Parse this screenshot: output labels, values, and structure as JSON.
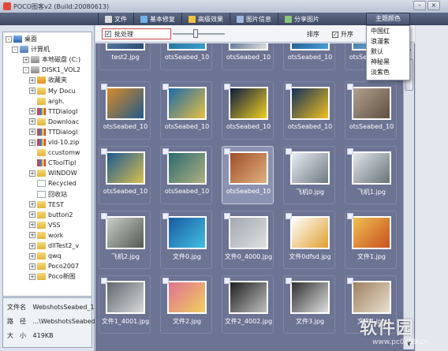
{
  "window": {
    "title": "POCO图客v2 (Build:20080613)"
  },
  "toolbar": {
    "items": [
      {
        "label": "文件",
        "icon": "file-icon",
        "color": "#d9d9d9"
      },
      {
        "label": "基本修复",
        "icon": "repair-icon",
        "color": "#6fb0e8"
      },
      {
        "label": "高级效果",
        "icon": "effects-icon",
        "color": "#f0c040"
      },
      {
        "label": "图片信息",
        "icon": "info-icon",
        "color": "#9fb8e0"
      },
      {
        "label": "分享图片",
        "icon": "share-icon",
        "color": "#8ac47a"
      }
    ],
    "theme_label": "主题颜色"
  },
  "theme_menu": {
    "items": [
      "中国红",
      "浪漫紫",
      "默认",
      "神秘黑",
      "淡紫色"
    ]
  },
  "tree": {
    "items": [
      {
        "label": "桌面",
        "icon": "desktop",
        "expander": "-"
      },
      {
        "label": "计算机",
        "icon": "computer",
        "expander": "-"
      },
      {
        "label": "本地磁盘 (C:)",
        "icon": "drive",
        "expander": "+"
      },
      {
        "label": "DISK1_VOL2",
        "icon": "drive",
        "expander": "-"
      },
      {
        "label": "收藏夹",
        "icon": "special",
        "expander": "+"
      },
      {
        "label": "My Docu",
        "icon": "folder",
        "expander": "+"
      },
      {
        "label": "argh.",
        "icon": "folder",
        "expander": ""
      },
      {
        "label": "TTDialogl",
        "icon": "zip",
        "expander": "+"
      },
      {
        "label": "Downloac",
        "icon": "folder",
        "expander": "+"
      },
      {
        "label": "TTDialogl",
        "icon": "zip",
        "expander": "+"
      },
      {
        "label": "vld-10.zip",
        "icon": "zip",
        "expander": "+"
      },
      {
        "label": "ccustomw",
        "icon": "folder",
        "expander": ""
      },
      {
        "label": "CToolTipl",
        "icon": "zip",
        "expander": ""
      },
      {
        "label": "WINDOW",
        "icon": "folder",
        "expander": "+"
      },
      {
        "label": "Recycled",
        "icon": "file",
        "expander": ""
      },
      {
        "label": "回收站",
        "icon": "file",
        "expander": ""
      },
      {
        "label": "TEST",
        "icon": "folder",
        "expander": "+"
      },
      {
        "label": "button2",
        "icon": "folder",
        "expander": "+"
      },
      {
        "label": "VSS",
        "icon": "folder",
        "expander": "+"
      },
      {
        "label": "work",
        "icon": "folder",
        "expander": "+"
      },
      {
        "label": "dllTest2_v",
        "icon": "folder",
        "expander": "+"
      },
      {
        "label": "qwq",
        "icon": "folder",
        "expander": "+"
      },
      {
        "label": "Poco2007",
        "icon": "folder",
        "expander": "+"
      },
      {
        "label": "Poco新图",
        "icon": "folder",
        "expander": "+"
      }
    ]
  },
  "file_info": {
    "name_label": "文件名",
    "name_value": "WebshotsSeabed_1",
    "path_label": "路　径",
    "path_value": "...\\WebshotsSeabed",
    "size_label": "大　小",
    "size_value": "419KB"
  },
  "options": {
    "batch_label": "批处理",
    "sort_label": "排序",
    "asc_label": "升序",
    "asc_checked": "✓"
  },
  "thumbnails": [
    {
      "caption": "test2.jpg",
      "colors": [
        "#6a8fb8",
        "#2b4a6e"
      ]
    },
    {
      "caption": "otsSeabed_10",
      "colors": [
        "#1f5c8a",
        "#3aa0c8"
      ]
    },
    {
      "caption": "otsSeabed_10",
      "colors": [
        "#1a3f6e",
        "#e0e0e0"
      ]
    },
    {
      "caption": "otsSeabed_10",
      "colors": [
        "#183a6a",
        "#48a0d8"
      ]
    },
    {
      "caption": "otsSeabed_10",
      "colors": [
        "#2a5e8e",
        "#7bb8e0"
      ]
    },
    {
      "caption": "otsSeabed_10",
      "colors": [
        "#d88a2a",
        "#205a8a"
      ]
    },
    {
      "caption": "otsSeabed_10",
      "colors": [
        "#1c6aa8",
        "#e8c040"
      ]
    },
    {
      "caption": "otsSeabed_10",
      "colors": [
        "#0a1a40",
        "#f0d020"
      ]
    },
    {
      "caption": "otsSeabed_10",
      "colors": [
        "#12305a",
        "#f0c020"
      ]
    },
    {
      "caption": "otsSeabed_10",
      "colors": [
        "#b0a090",
        "#605040"
      ]
    },
    {
      "caption": "otsSeabed_10",
      "colors": [
        "#1a5a90",
        "#d8c050"
      ]
    },
    {
      "caption": "otsSeabed_10",
      "colors": [
        "#2a6a70",
        "#b0b080"
      ]
    },
    {
      "caption": "otsSeabed_10",
      "colors": [
        "#a05028",
        "#e0b080"
      ]
    },
    {
      "caption": "飞机0.jpg",
      "colors": [
        "#e8eef4",
        "#707880"
      ]
    },
    {
      "caption": "飞机1.jpg",
      "colors": [
        "#dfe6ec",
        "#6a7278"
      ]
    },
    {
      "caption": "飞机2.jpg",
      "colors": [
        "#c8d0c8",
        "#505850"
      ]
    },
    {
      "caption": "文件0.jpg",
      "colors": [
        "#1a5aa0",
        "#40c0e0"
      ]
    },
    {
      "caption": "文件0_4000.jpg",
      "colors": [
        "#a0a8b0",
        "#e0e0e0"
      ]
    },
    {
      "caption": "文件0dfsd.jpg",
      "colors": [
        "#ffffff",
        "#e0a030"
      ]
    },
    {
      "caption": "文件1.jpg",
      "colors": [
        "#f0c050",
        "#c85020"
      ]
    },
    {
      "caption": "文件1_4001.jpg",
      "colors": [
        "#606870",
        "#d8d8d8"
      ]
    },
    {
      "caption": "文件2.jpg",
      "colors": [
        "#e07090",
        "#f0d060"
      ]
    },
    {
      "caption": "文件2_4002.jpg",
      "colors": [
        "#202020",
        "#c0c0c0"
      ]
    },
    {
      "caption": "文件3.jpg",
      "colors": [
        "#303030",
        "#e0e0e0"
      ]
    },
    {
      "caption": "文件4.jpg",
      "colors": [
        "#a08060",
        "#e8e0d0"
      ]
    }
  ],
  "watermark": {
    "text": "软件园",
    "sub": "www.pc0359.cn"
  }
}
